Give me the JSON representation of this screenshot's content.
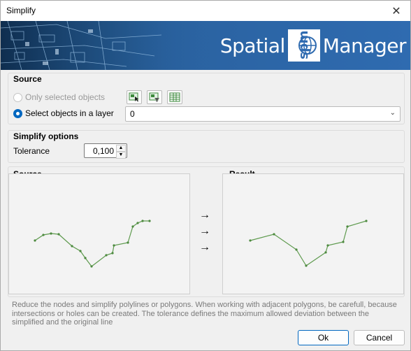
{
  "window": {
    "title": "Simplify",
    "close_icon": "close-icon"
  },
  "banner": {
    "brand_left": "Spatial",
    "brand_logo": "spm",
    "brand_right": "Manager"
  },
  "source": {
    "title": "Source",
    "option_selected": "Only selected objects",
    "option_layer": "Select objects in a layer",
    "selected_option": "layer",
    "tools": [
      "select-objects-icon",
      "filter-select-icon",
      "table-select-icon"
    ],
    "layer_value": "0"
  },
  "simplify": {
    "title": "Simplify options",
    "tolerance_label": "Tolerance",
    "tolerance_value": "0,100"
  },
  "preview": {
    "source_title": "Source",
    "result_title": "Result",
    "arrow": "→",
    "line_color": "#5e9a4e"
  },
  "description": "Reduce the nodes and simplify polylines or polygons. When working with adjacent polygons, be carefull, because intersections or holes can be created. The tolerance defines the maximum allowed deviation between the simplified and the original line",
  "buttons": {
    "ok": "Ok",
    "cancel": "Cancel"
  }
}
